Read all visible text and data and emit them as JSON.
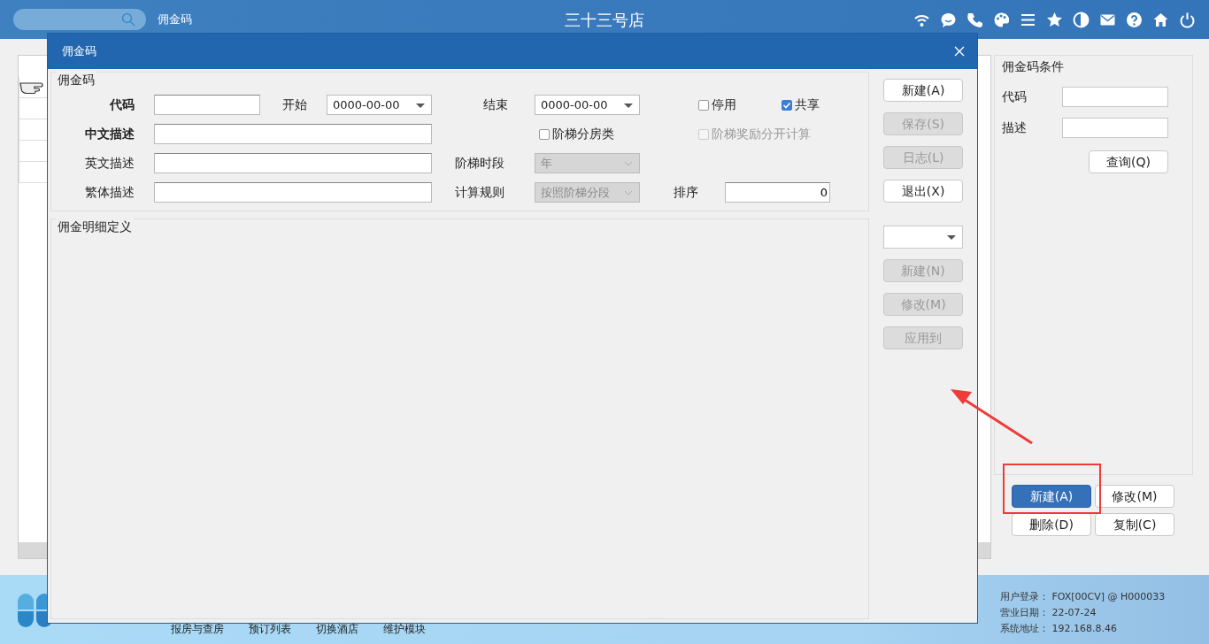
{
  "topbar": {
    "module_title": "佣金码",
    "store_name": "三十三号店"
  },
  "conditions": {
    "title": "佣金码条件",
    "fields": [
      {
        "label": "代码"
      },
      {
        "label": "描述"
      }
    ],
    "query_button": "查询(Q)"
  },
  "actions": [
    {
      "text": "新建(A)",
      "kind": "primary"
    },
    {
      "text": "修改(M)",
      "kind": "default"
    },
    {
      "text": "删除(D)",
      "kind": "default"
    },
    {
      "text": "复制(C)",
      "kind": "default"
    }
  ],
  "dialog": {
    "title": "佣金码",
    "group_title": "佣金码",
    "code": {
      "label": "代码",
      "required": true
    },
    "start": {
      "label": "开始",
      "value": "0000-00-00"
    },
    "end": {
      "label": "结束",
      "value": "0000-00-00"
    },
    "checkboxes": [
      {
        "label": "停用",
        "checked": false,
        "disabled": false
      },
      {
        "label": "共享",
        "checked": true,
        "disabled": false
      },
      {
        "label": "阶梯分房类",
        "checked": false,
        "disabled": false
      },
      {
        "label": "阶梯奖励分开计算",
        "checked": false,
        "disabled": true
      }
    ],
    "cn_desc": {
      "label": "中文描述",
      "required": true
    },
    "en_desc": {
      "label": "英文描述",
      "required": false
    },
    "tw_desc": {
      "label": "繁体描述",
      "required": false
    },
    "ladder_period": {
      "label": "阶梯时段",
      "value": "年",
      "disabled": true
    },
    "calc_rule": {
      "label": "计算规则",
      "value": "按照阶梯分段",
      "disabled": true
    },
    "sort": {
      "label": "排序",
      "value": "0"
    },
    "side_buttons": [
      {
        "text": "新建(A)",
        "disabled": false
      },
      {
        "text": "保存(S)",
        "disabled": true
      },
      {
        "text": "日志(L)",
        "disabled": true
      },
      {
        "text": "退出(X)",
        "disabled": false
      }
    ],
    "detail_title": "佣金明细定义",
    "detail_buttons": [
      {
        "text": "新建(N)",
        "disabled": true
      },
      {
        "text": "修改(M)",
        "disabled": true
      },
      {
        "text": "应用到",
        "disabled": true
      }
    ]
  },
  "footer": {
    "nav": [
      "报房与查房",
      "预订列表",
      "切换酒店",
      "维护模块"
    ],
    "status": [
      {
        "label": "用户登录：",
        "value": "FOX[00CV] @ H000033"
      },
      {
        "label": "营业日期：",
        "value": "22-07-24"
      },
      {
        "label": "系统地址：",
        "value": "192.168.8.46"
      }
    ]
  }
}
